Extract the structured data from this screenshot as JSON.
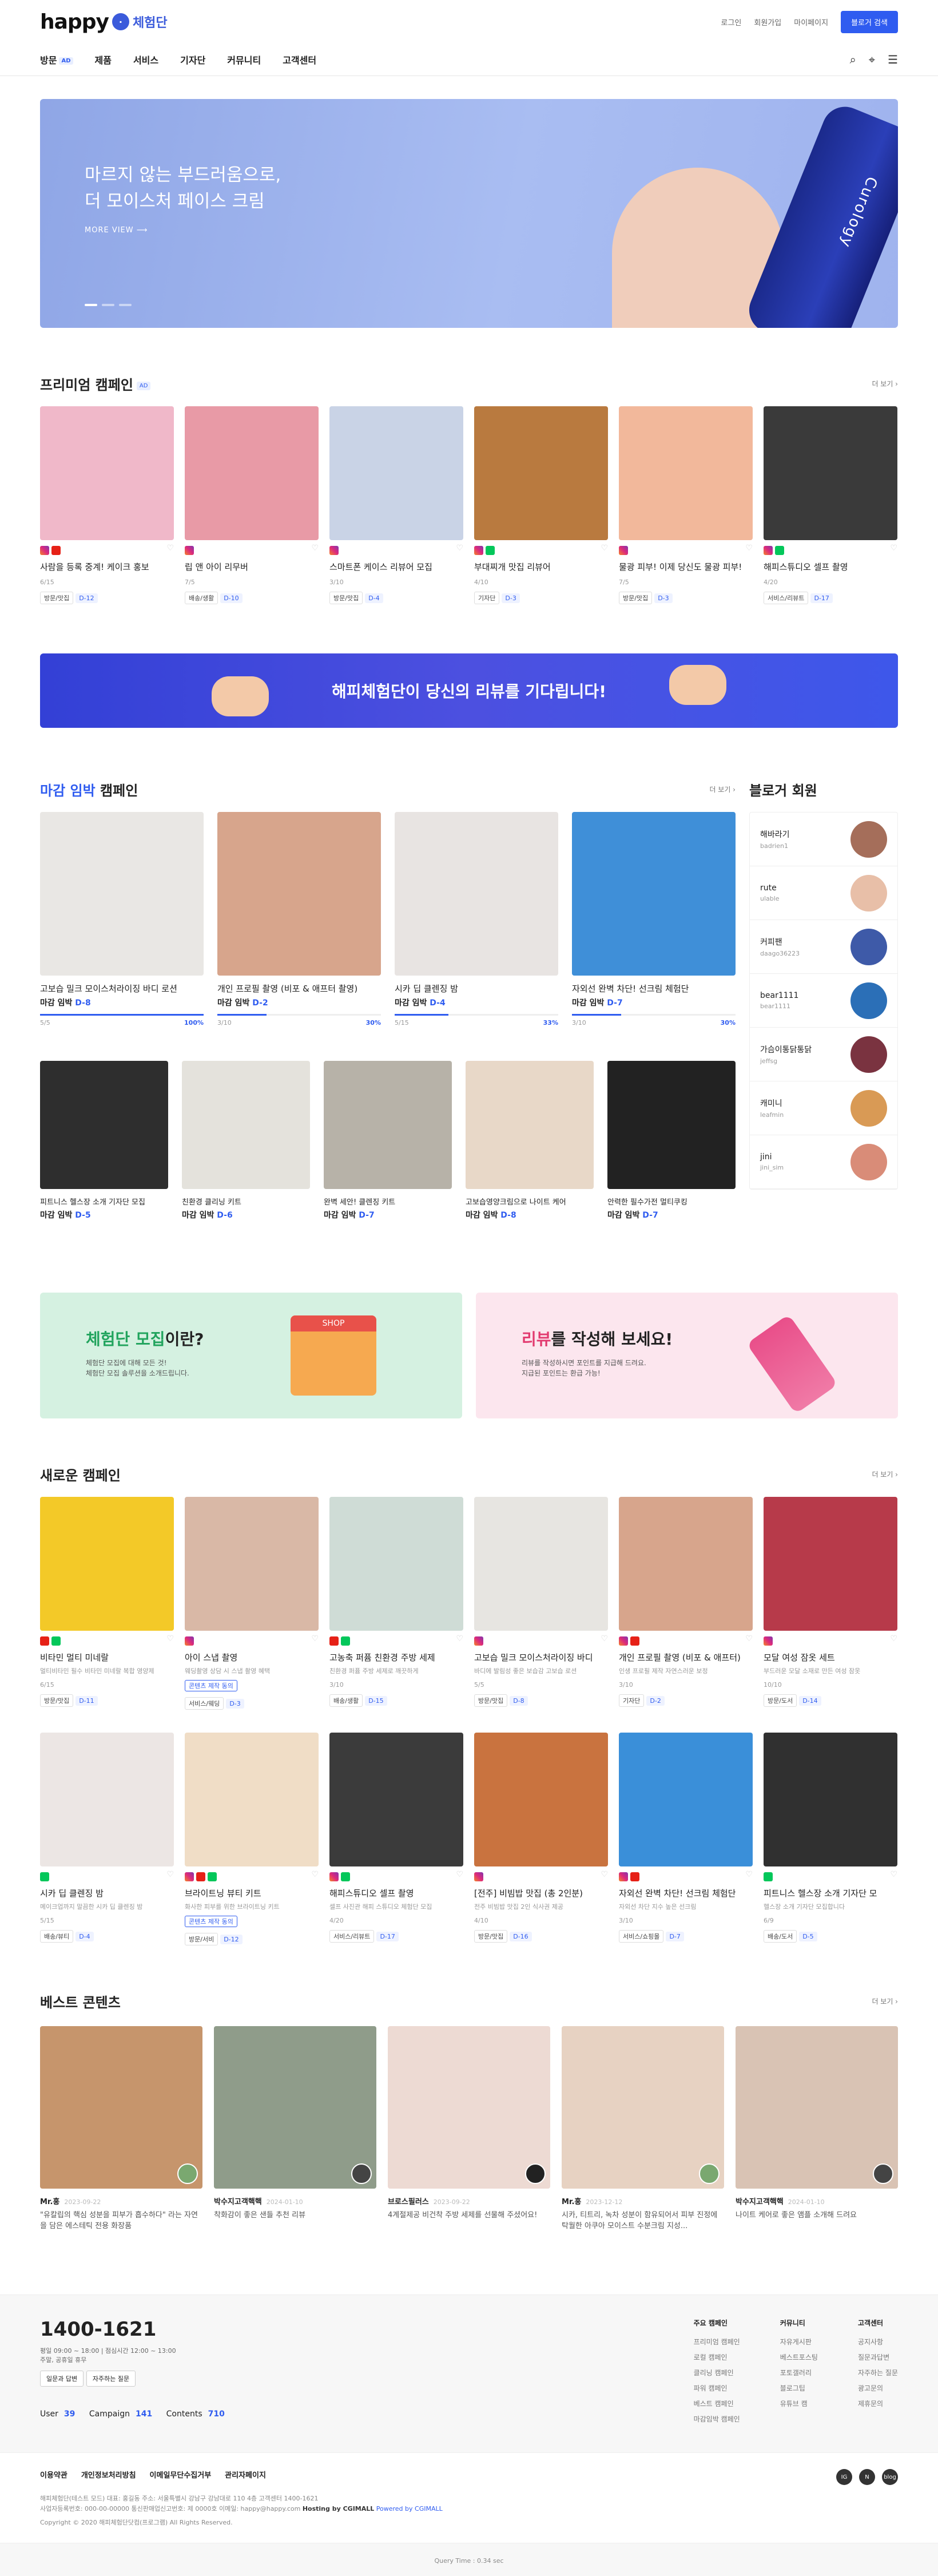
{
  "brand": {
    "word": "happy",
    "sub": "체험단"
  },
  "top_links": [
    "로그인",
    "회원가입",
    "마이페이지"
  ],
  "top_button": "블로거 검색",
  "nav": {
    "items": [
      "방문",
      "제품",
      "서비스",
      "기자단",
      "커뮤니티",
      "고객센터"
    ],
    "ad_badge": "AD"
  },
  "hero": {
    "line1": "마르지 않는 부드러움으로,",
    "line2": "더 모이스처 페이스 크림",
    "more": "MORE VIEW  ⟶",
    "bottle_text": "Curology"
  },
  "premium": {
    "title": "프리미엄 캠페인",
    "ad": "AD",
    "more": "더 보기 ›",
    "cards": [
      {
        "title": "사람을 등록 중계! 케이크 홍보",
        "count": "6/15",
        "tag": "방문/맛집",
        "dday": "D-12",
        "ch": [
          "ig",
          "yt"
        ],
        "color": "#f0b8c9"
      },
      {
        "title": "립 앤 아이 리무버",
        "count": "7/5",
        "tag": "배송/생활",
        "dday": "D-10",
        "ch": [
          "ig"
        ],
        "color": "#e89aa6"
      },
      {
        "title": "스마트폰 케이스 리뷰어 모집",
        "count": "3/10",
        "tag": "방문/맛집",
        "dday": "D-4",
        "ch": [
          "ig"
        ],
        "color": "#c9d3e6"
      },
      {
        "title": "부대찌개 맛집 리뷰어",
        "count": "4/10",
        "tag": "기자단",
        "dday": "D-3",
        "ch": [
          "ig",
          "nv"
        ],
        "color": "#b97a3f"
      },
      {
        "title": "물광 피부! 이제 당신도 물광 피부!",
        "count": "7/5",
        "tag": "방문/맛집",
        "dday": "D-3",
        "ch": [
          "ig"
        ],
        "color": "#f2b89b"
      },
      {
        "title": "해피스튜디오 셀프 촬영",
        "count": "4/20",
        "tag": "서비스/리뷰트",
        "dday": "D-17",
        "ch": [
          "ig",
          "nv"
        ],
        "color": "#3a3a3a"
      }
    ]
  },
  "banner": {
    "text": "해피체험단이 당신의 리뷰를 기다립니다!"
  },
  "deadline": {
    "title_hl": "마감 임박",
    "title_rest": " 캠페인",
    "more": "더 보기 ›",
    "dday_label": "마감 임박",
    "top": [
      {
        "title": "고보습 밀크 모이스처라이징 바디 로션",
        "dday": "D-8",
        "count": "5/5",
        "pct": "100%",
        "fill": 1.0,
        "color": "#e9e7e4"
      },
      {
        "title": "개인 프로필 촬영 (비포 & 애프터 촬영)",
        "dday": "D-2",
        "count": "3/10",
        "pct": "30%",
        "fill": 0.3,
        "color": "#d7a58c"
      },
      {
        "title": "시카 딥 클렌징 밤",
        "dday": "D-4",
        "count": "5/15",
        "pct": "33%",
        "fill": 0.33,
        "color": "#e8e4e2"
      },
      {
        "title": "자외선 완벽 차단! 선크림 체험단",
        "dday": "D-7",
        "count": "3/10",
        "pct": "30%",
        "fill": 0.3,
        "color": "#3f8fd8"
      }
    ],
    "bottom": [
      {
        "title": "피트니스 헬스장 소개 기자단 모집",
        "dday": "D-5",
        "color": "#2e2e2e"
      },
      {
        "title": "친환경 클리닝 키트",
        "dday": "D-6",
        "color": "#e4e2dc"
      },
      {
        "title": "완벽 세안! 클렌징 키트",
        "dday": "D-7",
        "color": "#b7b2a8"
      },
      {
        "title": "고보습영양크림으로 나이트 케어",
        "dday": "D-8",
        "color": "#e8d8c8"
      },
      {
        "title": "안력한 필수가전 멀티쿠킹",
        "dday": "D-7",
        "color": "#222222"
      }
    ]
  },
  "bloggers": {
    "title": "블로거 회원",
    "items": [
      {
        "name": "해바라기",
        "id": "badrien1",
        "color": "#a56e5a"
      },
      {
        "name": "rute",
        "id": "ulable",
        "color": "#e8bfa8"
      },
      {
        "name": "커피팬",
        "id": "daago36223",
        "color": "#3e5aa8"
      },
      {
        "name": "bear1111",
        "id": "bear1111",
        "color": "#2b6fb7"
      },
      {
        "name": "가슴이통닭통닭",
        "id": "jeffsg",
        "color": "#7a3340"
      },
      {
        "name": "캐미니",
        "id": "leafmin",
        "color": "#d99a55"
      },
      {
        "name": "jini",
        "id": "jini_sim",
        "color": "#d98c78"
      }
    ]
  },
  "promos": [
    {
      "h_hl": "체험단 모집",
      "h_rest": "이란?",
      "p1": "체험단 모집에 대해 모든 것!",
      "p2": "체험단 모집 솔루션을 소개드립니다.",
      "hl_color": "#21a45d",
      "bg": "#d5f1e1",
      "deco": "SHOP"
    },
    {
      "h_hl": "리뷰",
      "h_rest": "를 작성해 보세요!",
      "p1": "리뷰를 작성하시면 포인트를 지급해 드려요.",
      "p2": "지급된 포인트는 환급 가능!",
      "hl_color": "#e23a6f",
      "bg": "#fce6ee",
      "deco": ""
    }
  ],
  "newc": {
    "title": "새로운 캠페인",
    "more": "더 보기 ›",
    "premium_label": "콘텐츠 제작 동의",
    "cards": [
      {
        "title": "비타민 멀티 미네랄",
        "desc": "멀티비타민 필수 비타민 미네랄 복합 영양제",
        "count": "6/15",
        "tag": "방문/맛집",
        "dday": "D-11",
        "ch": [
          "yt",
          "nv"
        ],
        "color": "#f3c928",
        "prem": false
      },
      {
        "title": "아이 스냅 촬영",
        "desc": "웨딩촬영 상담 시 스냅 촬영 혜택",
        "count": "",
        "tag": "서비스/웨딩",
        "dday": "D-3",
        "ch": [
          "ig"
        ],
        "color": "#d9b8a6",
        "prem": true
      },
      {
        "title": "고농축 퍼퓸 친환경 주방 세제",
        "desc": "친환경 퍼퓸 주방 세제로 깨끗하게",
        "count": "3/10",
        "tag": "배송/생활",
        "dday": "D-15",
        "ch": [
          "yt",
          "nv"
        ],
        "color": "#cfdcd6",
        "prem": false
      },
      {
        "title": "고보습 밀크 모이스처라이징 바디",
        "desc": "바디에 발림성 좋은 보습감 고보습 로션",
        "count": "5/5",
        "tag": "방문/맛집",
        "dday": "D-8",
        "ch": [
          "ig"
        ],
        "color": "#e7e5e1",
        "prem": false
      },
      {
        "title": "개인 프로필 촬영 (비포 & 애프터)",
        "desc": "인생 프로필 제작 자연스러운 보정",
        "count": "3/10",
        "tag": "기자단",
        "dday": "D-2",
        "ch": [
          "ig",
          "yt"
        ],
        "color": "#d7a58c",
        "prem": false
      },
      {
        "title": "모달 여성 잠옷 세트",
        "desc": "부드러운 모달 소재로 만든 여성 잠옷",
        "count": "10/10",
        "tag": "방문/도서",
        "dday": "D-14",
        "ch": [
          "ig"
        ],
        "color": "#b73a4a",
        "prem": false
      },
      {
        "title": "시카 딥 클렌징 밤",
        "desc": "메이크업까지 말끔한 시카 딥 클렌징 밤",
        "count": "5/15",
        "tag": "배송/뷰티",
        "dday": "D-4",
        "ch": [
          "nv"
        ],
        "color": "#ece6e4",
        "prem": false
      },
      {
        "title": "브라이트닝 뷰티 키트",
        "desc": "화사한 피부를 위한 브라이트닝 키트",
        "count": "",
        "tag": "방문/서비",
        "dday": "D-12",
        "ch": [
          "ig",
          "yt",
          "nv"
        ],
        "color": "#f0ddc6",
        "prem": true
      },
      {
        "title": "해피스튜디오 셀프 촬영",
        "desc": "셀프 사진관 해피 스튜디오 체험단 모집",
        "count": "4/20",
        "tag": "서비스/리뷰트",
        "dday": "D-17",
        "ch": [
          "ig",
          "nv"
        ],
        "color": "#3b3b3b",
        "prem": false
      },
      {
        "title": "[전주] 비빔밥 맛집 (총 2인분)",
        "desc": "전주 비빔밥 맛집 2인 식사권 제공",
        "count": "4/10",
        "tag": "방문/맛집",
        "dday": "D-16",
        "ch": [
          "ig"
        ],
        "color": "#c9733f",
        "prem": false
      },
      {
        "title": "자외선 완벽 차단! 선크림 체험단",
        "desc": "자외선 차단 지수 높은 선크림",
        "count": "3/10",
        "tag": "서비스/쇼핑몰",
        "dday": "D-7",
        "ch": [
          "ig",
          "yt"
        ],
        "color": "#3a8fd9",
        "prem": false
      },
      {
        "title": "피트니스 헬스장 소개 기자단 모",
        "desc": "헬스장 소개 기자단 모집합니다",
        "count": "6/9",
        "tag": "배송/도서",
        "dday": "D-5",
        "ch": [
          "nv"
        ],
        "color": "#303030",
        "prem": false
      }
    ]
  },
  "best": {
    "title": "베스트 콘텐츠",
    "more": "더 보기 ›",
    "items": [
      {
        "who": "Mr.홍",
        "date": "2023-09-22",
        "txt": "\"유칼립의 핵심 성분을 피부가 흡수하다\" 라는 자연을 담은 에스테틱 전용 화장품",
        "color": "#c6956c",
        "ava": "#7aa870"
      },
      {
        "who": "박수지고객핵핵",
        "date": "2024-01-10",
        "txt": "착화감이 좋은 샌들 추천 리뷰",
        "color": "#8f9c8a",
        "ava": "#444"
      },
      {
        "who": "브로스필러스",
        "date": "2023-09-22",
        "txt": "4계절제공 비건착 주방 세제를 선물해 주셨어요!",
        "color": "#eddad3",
        "ava": "#222"
      },
      {
        "who": "Mr.홍",
        "date": "2023-12-12",
        "txt": "시카, 티트리, 녹차 성분이 함유되어서 피부 진정에 탁월한 아쿠아 모이스트 수분크림 지성...",
        "color": "#e7d2c2",
        "ava": "#7aa870"
      },
      {
        "who": "박수지고객핵핵",
        "date": "2024-01-10",
        "txt": "나이트 케어로 좋은 앰플 소개해 드려요",
        "color": "#d9c3b4",
        "ava": "#444"
      }
    ]
  },
  "footer": {
    "tel": "1400-1621",
    "hrs1": "평일 09:00 ~ 18:00 | 점심시간 12:00 ~ 13:00",
    "hrs2": "주말, 공휴일 휴무",
    "btn1": "일문과 답변",
    "btn2": "자주하는 질문",
    "stats": [
      {
        "k": "User",
        "v": "39"
      },
      {
        "k": "Campaign",
        "v": "141"
      },
      {
        "k": "Contents",
        "v": "710"
      }
    ],
    "cols": [
      {
        "h": "주요 캠페인",
        "items": [
          "프리미엄 캠페인",
          "로컬 캠페인",
          "클리닝 캠페인",
          "파워 캠페인",
          "베스트 캠페인",
          "마감임박 캠페인"
        ]
      },
      {
        "h": "커뮤니티",
        "items": [
          "자유게시판",
          "베스트포스팅",
          "포토갤러리",
          "블로그팁",
          "유튜브 캠"
        ]
      },
      {
        "h": "고객센터",
        "items": [
          "공지사항",
          "질문과답변",
          "자주하는 질문",
          "광고문의",
          "제휴문의"
        ]
      }
    ],
    "links": [
      "이용약관",
      "개인정보처리방침",
      "이메일무단수집거부",
      "관리자페이지"
    ],
    "info1": "해피체험단(테스트 모드)  대표: 홍길동  주소: 서울특별시 강남구 강남대로 110 4층  고객센터 1400-1621",
    "info2": "사업자등록번호: 000-00-00000  통신판매업신고번호: 제 0000호  이메일: happy@happy.com",
    "host": "Hosting by CGIMALL",
    "powered": "Powered by CGIMALL",
    "copy": "Copyright © 2020 해피체험단닷컴(프로그램) All Rights Reserved.",
    "sns": [
      "IG",
      "N",
      "blog"
    ],
    "qtime": "Query Time : 0.34 sec"
  }
}
